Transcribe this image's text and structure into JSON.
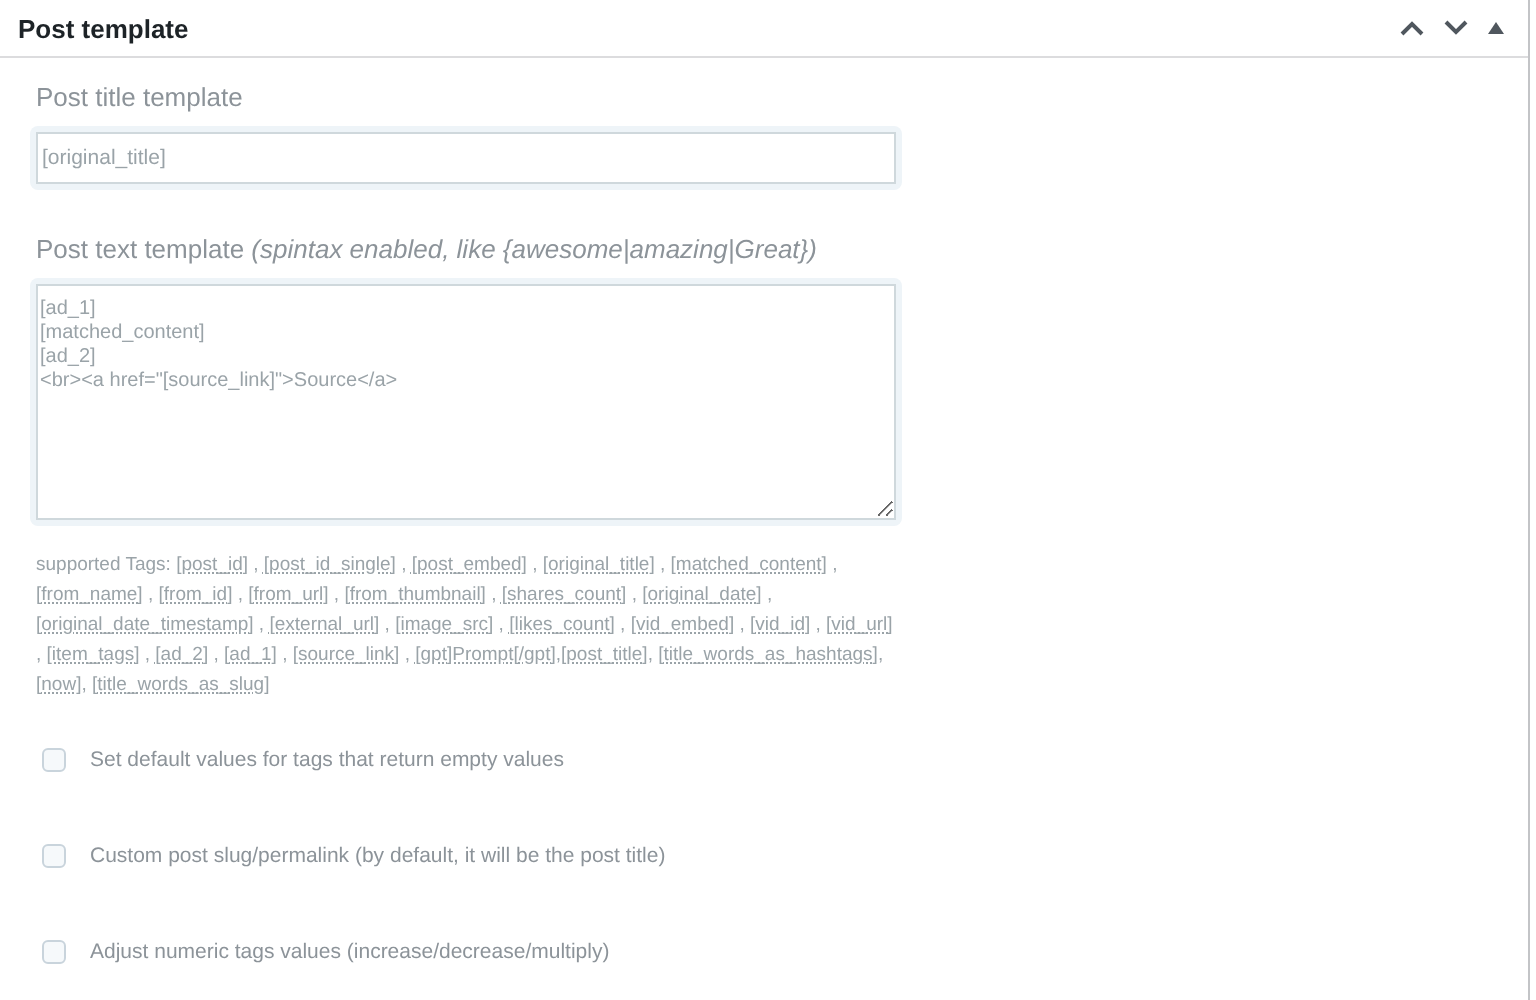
{
  "panel": {
    "title": "Post template"
  },
  "title_field": {
    "label": "Post title template",
    "value": "[original_title]"
  },
  "text_field": {
    "label": "Post text template",
    "hint": "(spintax enabled, like {awesome|amazing|Great})",
    "value": "[ad_1]\n[matched_content]\n[ad_2]\n<br><a href=\"[source_link]\">Source</a>"
  },
  "supported_tags": {
    "label": "supported Tags:",
    "tags": [
      {
        "tag": "[post_id]",
        "after": " , "
      },
      {
        "tag": "[post_id_single]",
        "after": " , "
      },
      {
        "tag": "[post_embed]",
        "after": " , "
      },
      {
        "tag": "[original_title]",
        "after": " , "
      },
      {
        "tag": "[matched_content]",
        "after": " , "
      },
      {
        "tag": "[from_name]",
        "after": " , "
      },
      {
        "tag": "[from_id]",
        "after": " , "
      },
      {
        "tag": "[from_url]",
        "after": " , "
      },
      {
        "tag": "[from_thumbnail]",
        "after": " , "
      },
      {
        "tag": "[shares_count]",
        "after": " , "
      },
      {
        "tag": "[original_date]",
        "after": " , "
      },
      {
        "tag": "[original_date_timestamp]",
        "after": " , "
      },
      {
        "tag": "[external_url]",
        "after": " , "
      },
      {
        "tag": "[image_src]",
        "after": " , "
      },
      {
        "tag": "[likes_count]",
        "after": " , "
      },
      {
        "tag": "[vid_embed]",
        "after": " , "
      },
      {
        "tag": "[vid_id]",
        "after": " , "
      },
      {
        "tag": "[vid_url]",
        "after": " , "
      },
      {
        "tag": "[item_tags]",
        "after": " , "
      },
      {
        "tag": "[ad_2]",
        "after": " , "
      },
      {
        "tag": "[ad_1]",
        "after": " , "
      },
      {
        "tag": "[source_link]",
        "after": " , "
      },
      {
        "tag": "[gpt]Prompt[/gpt]",
        "after": ","
      },
      {
        "tag": "[post_title]",
        "after": ", "
      },
      {
        "tag": "[title_words_as_hashtags]",
        "after": ", "
      },
      {
        "tag": "[now]",
        "after": ", "
      },
      {
        "tag": "[title_words_as_slug]"
      }
    ]
  },
  "options": [
    {
      "label": "Set default values for tags that return empty values",
      "checked": false
    },
    {
      "label": "Custom post slug/permalink (by default, it will be the post title)",
      "checked": false
    },
    {
      "label": "Adjust numeric tags values (increase/decrease/multiply)",
      "checked": false
    }
  ]
}
